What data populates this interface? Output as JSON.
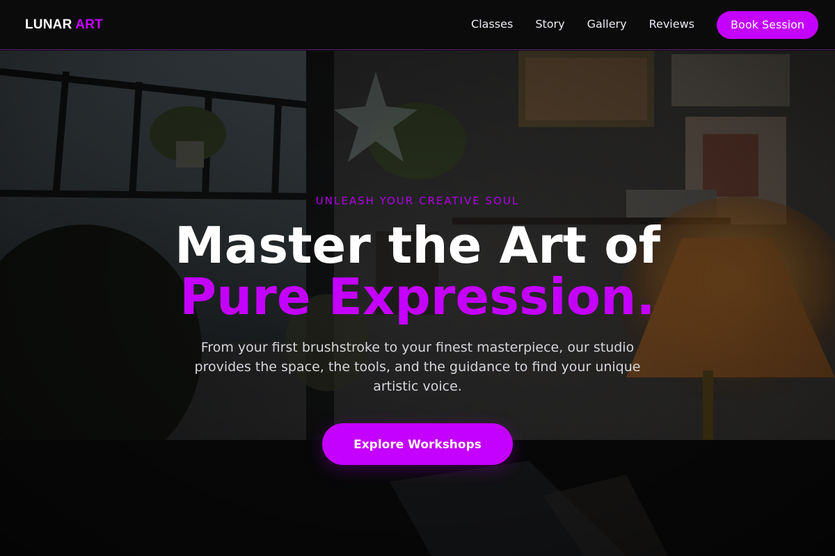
{
  "brand": {
    "name": "LUNAR",
    "accent": "ART"
  },
  "nav": {
    "links": [
      {
        "label": "Classes"
      },
      {
        "label": "Story"
      },
      {
        "label": "Gallery"
      },
      {
        "label": "Reviews"
      }
    ],
    "cta_label": "Book Session"
  },
  "hero": {
    "eyebrow": "UNLEASH YOUR CREATIVE SOUL",
    "headline_line1": "Master the Art of",
    "headline_line2": "Pure Expression.",
    "subtext": "From your first brushstroke to your finest masterpiece, our studio provides the space, the tools, and the guidance to find your unique artistic voice.",
    "cta_label": "Explore Workshops"
  },
  "colors": {
    "accent": "#c400ff",
    "nav_background": "#0b0b0c",
    "text_primary": "#ffffff",
    "text_muted": "#d6d6dc"
  }
}
